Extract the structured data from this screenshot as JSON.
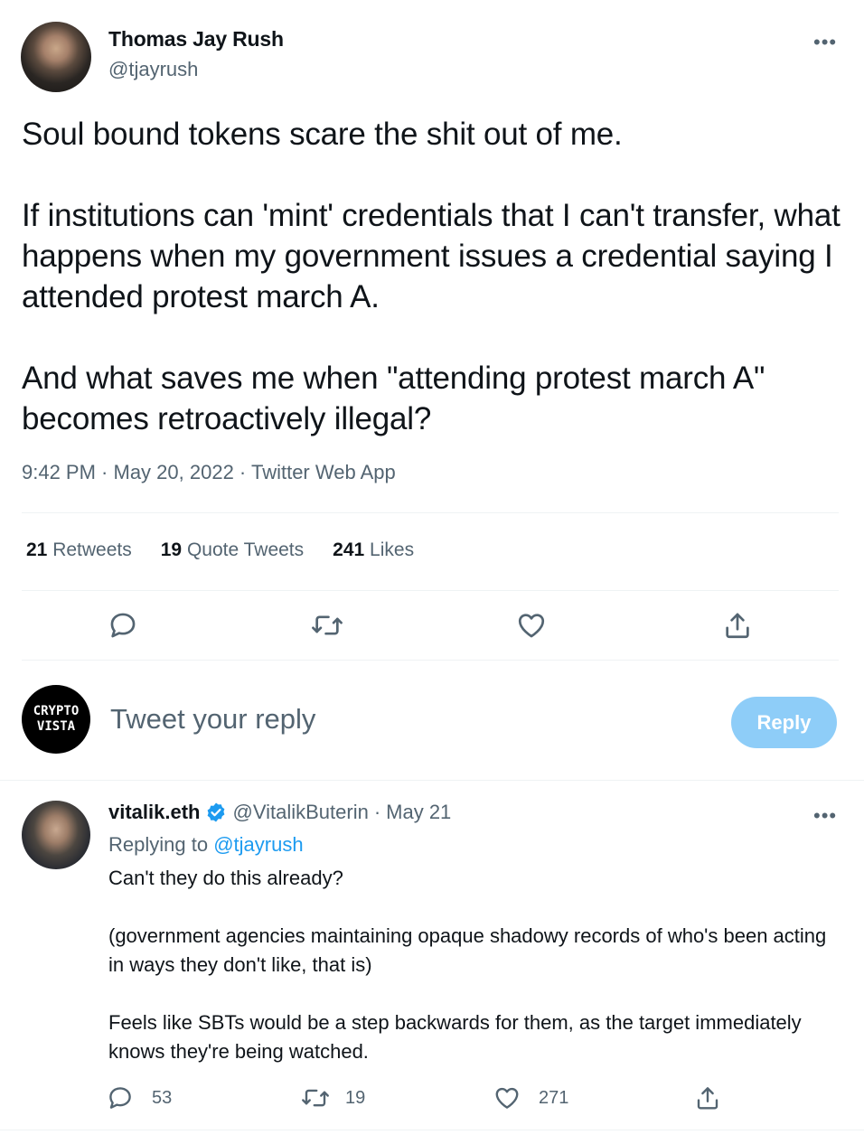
{
  "tweet": {
    "author_name": "Thomas Jay Rush",
    "author_handle": "@tjayrush",
    "more_label": "•••",
    "paragraphs": [
      "Soul bound tokens scare the shit out of me.",
      "If institutions can 'mint' credentials that I can't transfer, what happens when my government issues a credential saying I attended protest march A.",
      "And what saves me when \"attending protest march A\" becomes retroactively illegal?"
    ],
    "time": "9:42 PM",
    "date": "May 20, 2022",
    "source": "Twitter Web App",
    "separator": " · ",
    "stats": {
      "retweets_count": "21",
      "retweets_label": "Retweets",
      "quotes_count": "19",
      "quotes_label": "Quote Tweets",
      "likes_count": "241",
      "likes_label": "Likes"
    }
  },
  "composer": {
    "avatar_line1": "CRYPTO",
    "avatar_line2": "VISTA",
    "placeholder": "Tweet your reply",
    "reply_button": "Reply"
  },
  "reply": {
    "name": "vitalik.eth",
    "handle": "@VitalikButerin",
    "separator": "·",
    "date": "May 21",
    "replying_prefix": "Replying to",
    "replying_handle": "@tjayrush",
    "more_label": "•••",
    "paragraphs": [
      "Can't they do this already?",
      "(government agencies maintaining opaque shadowy records of who's been acting in ways they don't like, that is)",
      "Feels like SBTs would be a step backwards for them, as the target immediately knows they're being watched."
    ],
    "reply_count": "53",
    "retweet_count": "19",
    "like_count": "271"
  },
  "colors": {
    "text": "#0f1419",
    "secondary": "#536471",
    "accent": "#1d9bf0",
    "reply_button_disabled": "#8ecdf8",
    "divider": "#eff3f4"
  }
}
